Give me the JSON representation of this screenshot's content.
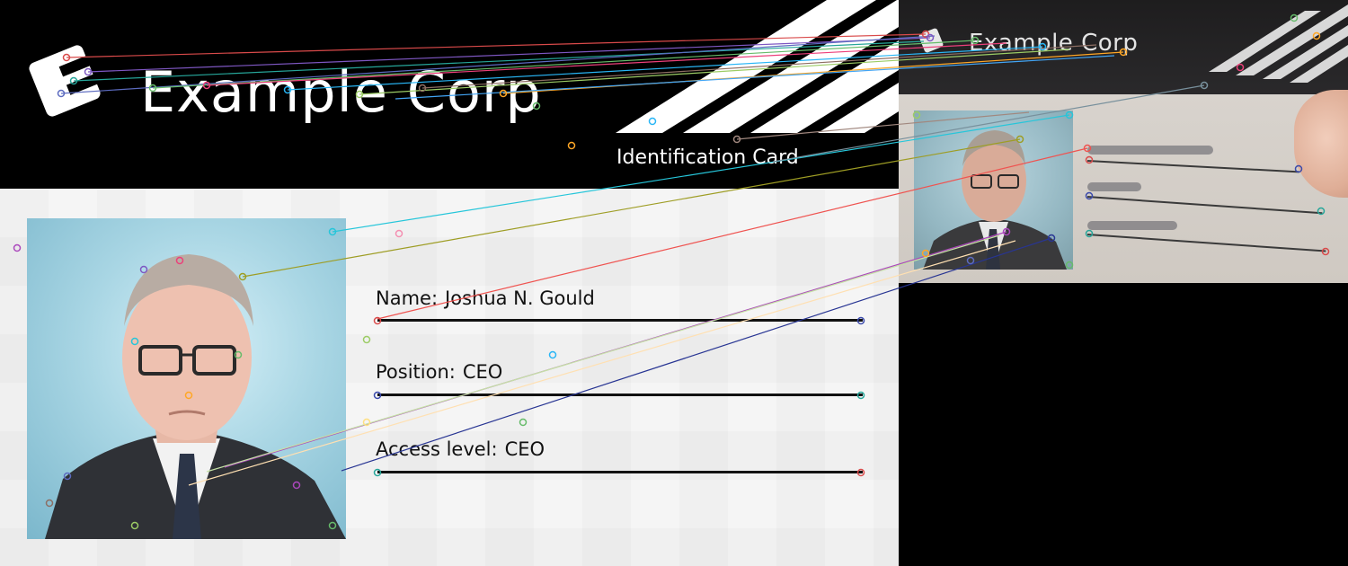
{
  "card": {
    "company": "Example Corp",
    "subtitle": "Identification Card",
    "fields": {
      "name_label": "Name:",
      "name_value": "Joshua N. Gould",
      "position_label": "Position:",
      "position_value": "CEO",
      "access_label": "Access level:",
      "access_value": "CEO"
    }
  },
  "capture": {
    "company": "Example Corp"
  },
  "colors": {
    "header_bg": "#000000",
    "card_bg": "#f3f3f3",
    "photo_bg": "#a9d6e4",
    "suit": "#2f3136",
    "tie": "#2c3548"
  },
  "icons": {
    "logo": "e-logo-icon"
  }
}
